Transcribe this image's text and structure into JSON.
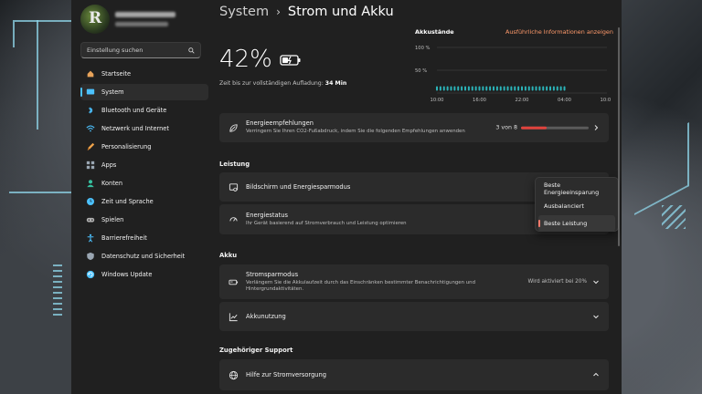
{
  "window": {
    "breadcrumb_parent": "System",
    "breadcrumb_separator": "›",
    "breadcrumb_current": "Strom und Akku"
  },
  "sidebar": {
    "search_placeholder": "Einstellung suchen",
    "items": [
      {
        "label": "Startseite",
        "icon": "home-icon",
        "color": "#e8a35a"
      },
      {
        "label": "System",
        "icon": "display-icon",
        "color": "#4cc2ff",
        "active": true
      },
      {
        "label": "Bluetooth und Geräte",
        "icon": "bluetooth-icon",
        "color": "#4cc2ff"
      },
      {
        "label": "Netzwerk und Internet",
        "icon": "wifi-icon",
        "color": "#4cc2ff"
      },
      {
        "label": "Personalisierung",
        "icon": "brush-icon",
        "color": "#f0a34a"
      },
      {
        "label": "Apps",
        "icon": "apps-icon",
        "color": "#9aa6b2"
      },
      {
        "label": "Konten",
        "icon": "person-icon",
        "color": "#36c0a0"
      },
      {
        "label": "Zeit und Sprache",
        "icon": "globe-clock-icon",
        "color": "#4cc2ff"
      },
      {
        "label": "Spielen",
        "icon": "gamepad-icon",
        "color": "#b0b0b0"
      },
      {
        "label": "Barrierefreiheit",
        "icon": "accessibility-icon",
        "color": "#4cc2ff"
      },
      {
        "label": "Datenschutz und Sicherheit",
        "icon": "shield-icon",
        "color": "#9aa6b2"
      },
      {
        "label": "Windows Update",
        "icon": "update-icon",
        "color": "#4cc2ff"
      }
    ]
  },
  "battery": {
    "percent": "42%",
    "charge_label": "Zeit bis zur vollständigen Aufladung:",
    "charge_value": "34 Min"
  },
  "chart_header": {
    "title": "Akkustände",
    "link": "Ausführliche Informationen anzeigen"
  },
  "chart_data": {
    "type": "scatter",
    "title": "Akkustände",
    "x_tick_labels": [
      "10:00",
      "16:00",
      "22:00",
      "04:00",
      "10:00"
    ],
    "y_tick_labels": [
      "100 %",
      "50 %"
    ],
    "ylim": [
      0,
      100
    ],
    "series": [
      {
        "values": [
          10,
          10,
          10,
          10,
          10,
          10,
          10,
          10,
          10,
          10,
          10,
          10,
          10,
          10,
          10,
          10,
          10,
          10,
          10,
          10,
          10,
          10,
          10,
          10,
          10,
          10,
          10,
          10,
          10,
          10,
          10,
          10,
          10,
          10,
          10,
          10,
          10
        ]
      }
    ],
    "x": [
      0,
      0.5,
      1,
      1.5,
      2,
      2.5,
      3,
      3.5,
      4,
      4.5,
      5,
      5.5,
      6,
      6.5,
      7,
      7.5,
      8,
      8.5,
      9,
      9.5,
      10,
      10.5,
      11,
      11.5,
      12,
      12.5,
      13,
      13.5,
      14,
      14.5,
      15,
      15.5,
      16,
      16.5,
      17,
      17.5,
      18
    ],
    "xlim": [
      0,
      24
    ],
    "grid": true,
    "point_color": "#2bb3b8"
  },
  "recommendations": {
    "title": "Energieempfehlungen",
    "subtitle": "Verringern Sie Ihren CO2-Fußabdruck, indem Sie die folgenden Empfehlungen anwenden",
    "count": "3 von 8",
    "progress_fraction": 0.375,
    "progress_color": "#e0423c"
  },
  "performance": {
    "section_title": "Leistung",
    "screen_title": "Bildschirm und Energiesparmodus",
    "mode_title": "Energiestatus",
    "mode_subtitle": "Ihr Gerät basierend auf Stromverbrauch und Leistung optimieren",
    "options": [
      "Beste Energieeinsparung",
      "Ausbalanciert",
      "Beste Leistung"
    ],
    "selected_option": "Beste Leistung"
  },
  "akku": {
    "section_title": "Akku",
    "saver_title": "Stromsparmodus",
    "saver_subtitle_line1": "Verlängern Sie die Akkulaufzeit durch das Einschränken bestimmter Benachrichtigungen und",
    "saver_subtitle_line2": "Hintergrundaktivitäten.",
    "saver_status": "Wird aktiviert bei 20%",
    "usage_title": "Akkunutzung"
  },
  "support": {
    "section_title": "Zugehöriger Support",
    "help_title": "Hilfe zur Stromversorgung"
  }
}
